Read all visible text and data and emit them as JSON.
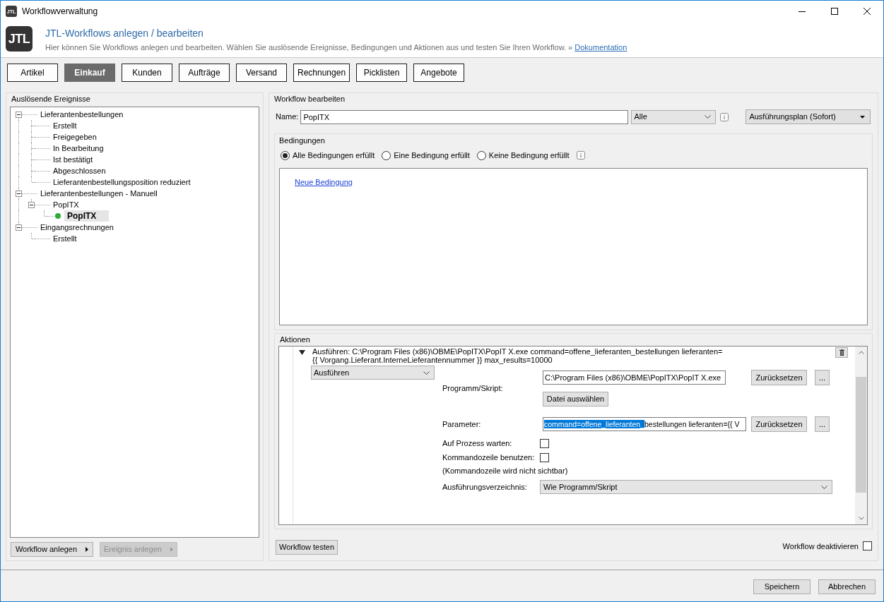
{
  "window": {
    "app_icon": "JTL",
    "title": "Workflowverwaltung"
  },
  "header": {
    "logo": "JTL",
    "title": "JTL-Workflows anlegen / bearbeiten",
    "description": "Hier können Sie Workflows anlegen und bearbeiten. Wählen Sie auslösende Ereignisse, Bedingungen und Aktionen aus und testen Sie Ihren Workflow. »",
    "link": "Dokumentation"
  },
  "tabs": [
    {
      "label": "Artikel",
      "selected": false
    },
    {
      "label": "Einkauf",
      "selected": true
    },
    {
      "label": "Kunden",
      "selected": false
    },
    {
      "label": "Aufträge",
      "selected": false
    },
    {
      "label": "Versand",
      "selected": false
    },
    {
      "label": "Rechnungen",
      "selected": false
    },
    {
      "label": "Picklisten",
      "selected": false
    },
    {
      "label": "Angebote",
      "selected": false
    }
  ],
  "events_panel": {
    "title": "Auslösende Ereignisse",
    "tree": [
      {
        "label": "Lieferantenbestellungen",
        "expanded": true,
        "selected": false,
        "children": [
          {
            "label": "Erstellt",
            "selected": false
          },
          {
            "label": "Freigegeben",
            "selected": false
          },
          {
            "label": "In Bearbeitung",
            "selected": false
          },
          {
            "label": "Ist bestätigt",
            "selected": false
          },
          {
            "label": "Abgeschlossen",
            "selected": false
          },
          {
            "label": "Lieferantenbestellungsposition reduziert",
            "selected": false
          }
        ]
      },
      {
        "label": "Lieferantenbestellungen - Manuell",
        "expanded": true,
        "selected": false,
        "children": [
          {
            "label": "PopITX",
            "expanded": true,
            "selected": false,
            "children": [
              {
                "label": "PopITX",
                "kind": "workflow",
                "active": true,
                "selected": true
              }
            ]
          }
        ]
      },
      {
        "label": "Eingangsrechnungen",
        "expanded": true,
        "selected": false,
        "children": [
          {
            "label": "Erstellt",
            "selected": false
          }
        ]
      }
    ],
    "buttons": [
      {
        "label": "Workflow anlegen",
        "disabled": false
      },
      {
        "label": "Ereignis anlegen",
        "disabled": true
      }
    ]
  },
  "workflow_panel": {
    "title": "Workflow bearbeiten",
    "name_label": "Name:",
    "name_value": "PopITX",
    "scope": "Alle",
    "schedule": "Ausführungsplan (Sofort)",
    "conditions": {
      "title": "Bedingungen",
      "modes": [
        {
          "label": "Alle Bedingungen erfüllt",
          "selected": true
        },
        {
          "label": "Eine Bedingung erfüllt",
          "selected": false
        },
        {
          "label": "Keine Bedingung erfüllt",
          "selected": false
        }
      ],
      "add_link": "Neue Bedingung"
    },
    "actions": {
      "title": "Aktionen",
      "items": [
        {
          "expanded": true,
          "summary": [
            "Ausführen: C:\\Program Files (x86)\\OBME\\PopITX\\PopIT X.exe command=offene_lieferanten_bestellungen lieferanten=",
            "{{ Vorgang.Lieferant.InterneLieferantennummer }} max_results=10000"
          ],
          "type": "Ausführen",
          "program": {
            "label": "Programm/Skript:",
            "value": "C:\\Program Files (x86)\\OBME\\PopITX\\PopIT X.exe",
            "buttons": [
              "Zurücksetzen",
              "..."
            ],
            "choose_button": "Datei auswählen"
          },
          "parameter": {
            "label": "Parameter:",
            "value_parts": [
              {
                "text": "command=offene_lieferanten_",
                "selected": true
              },
              {
                "text": "bestellungen lieferanten={{ V",
                "selected": false
              }
            ],
            "buttons": [
              "Zurücksetzen",
              "..."
            ]
          },
          "options": [
            {
              "label": "Auf Prozess warten:",
              "checked": false
            },
            {
              "label": "Kommandozeile benutzen:",
              "checked": false
            }
          ],
          "note": "(Kommandozeile wird nicht sichtbar)",
          "directory": {
            "label": "Ausführungsverzeichnis:",
            "value": "Wie Programm/Skript"
          }
        }
      ]
    },
    "test_button": "Workflow testen",
    "deactivate": {
      "label": "Workflow deaktivieren",
      "checked": false
    }
  },
  "footer": {
    "buttons": [
      "Speichern",
      "Abbrechen"
    ]
  }
}
